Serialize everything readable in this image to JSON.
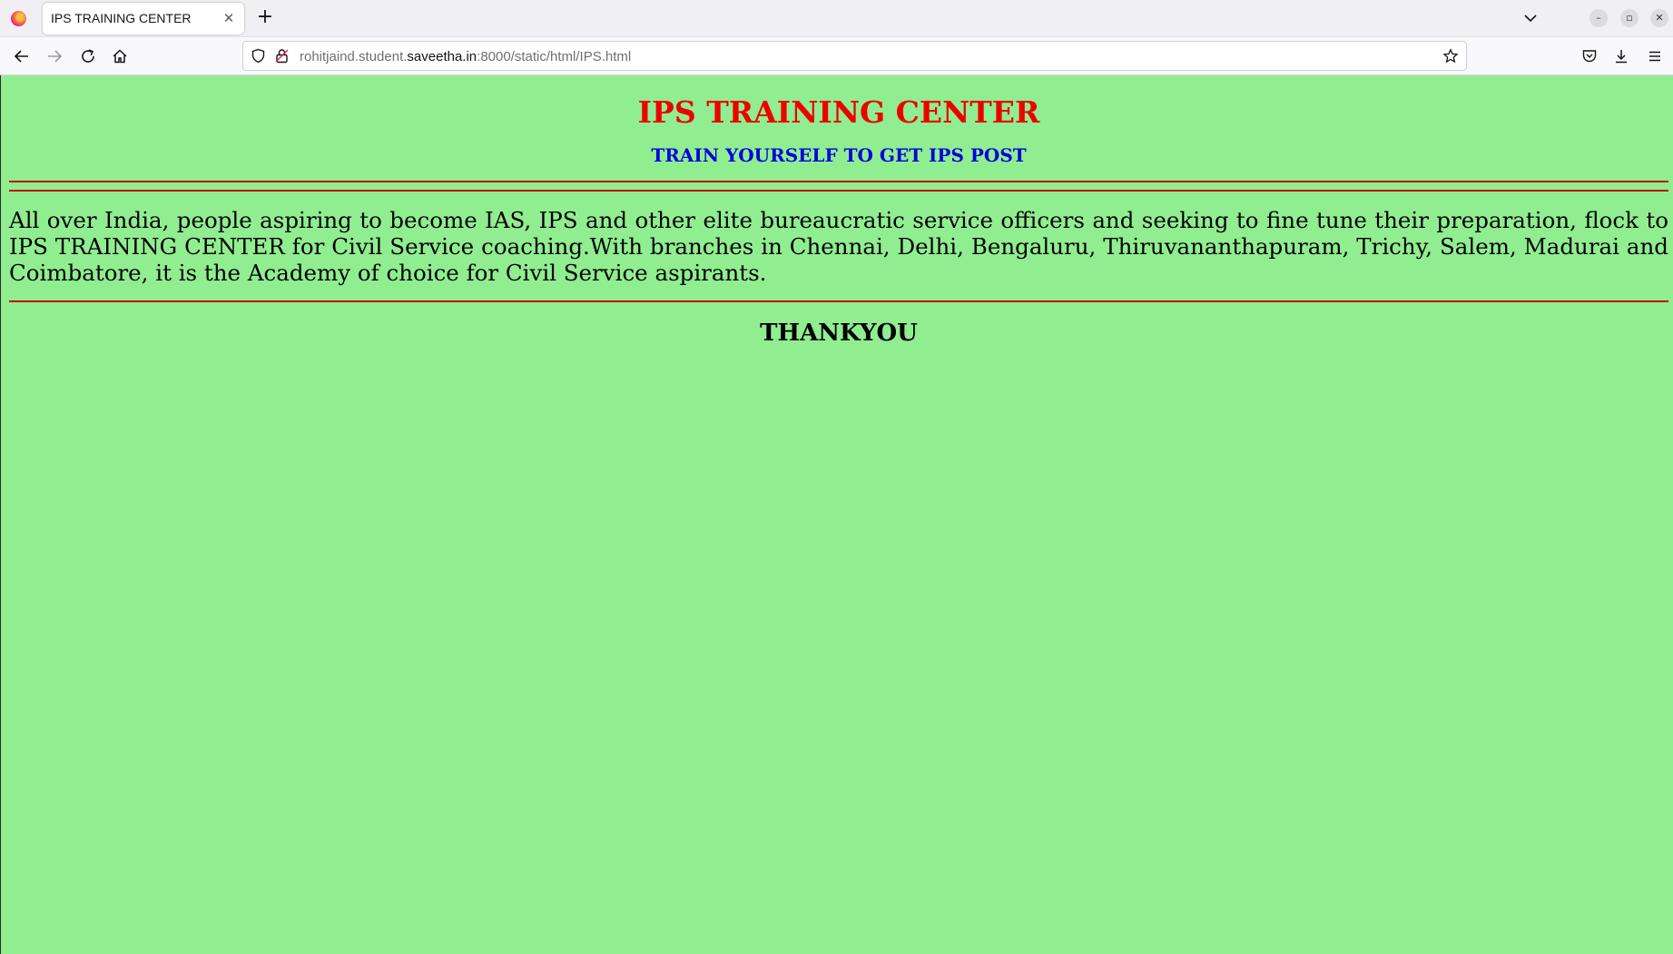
{
  "browser": {
    "tab_title": "IPS TRAINING CENTER",
    "url_prefix": "rohitjaind.student.",
    "url_host": "saveetha.in",
    "url_suffix": ":8000/static/html/IPS.html"
  },
  "page": {
    "heading": "IPS TRAINING CENTER",
    "subheading": "TRAIN YOURSELF TO GET IPS POST",
    "paragraph": "All over India, people aspiring to become IAS, IPS and other elite bureaucratic service officers and seeking to fine tune their preparation, flock to IPS TRAINING CENTER for Civil Service coaching.With branches in Chennai, Delhi, Bengaluru, Thiruvananthapuram, Trichy, Salem, Madurai and Coimbatore, it is the Academy of choice for Civil Service aspirants.",
    "footer": "THANKYOU"
  },
  "colors": {
    "background": "#90ee90",
    "heading": "#ee0000",
    "subheading": "#0000dd",
    "rule": "#c40000"
  },
  "icons": [
    "firefox-logo-icon",
    "close-icon",
    "plus-icon",
    "chevron-down-icon",
    "minimize-icon",
    "restore-icon",
    "window-close-icon",
    "back-arrow-icon",
    "forward-arrow-icon",
    "reload-icon",
    "home-icon",
    "shield-icon",
    "lock-icon",
    "star-icon",
    "pocket-icon",
    "download-icon",
    "menu-icon"
  ]
}
